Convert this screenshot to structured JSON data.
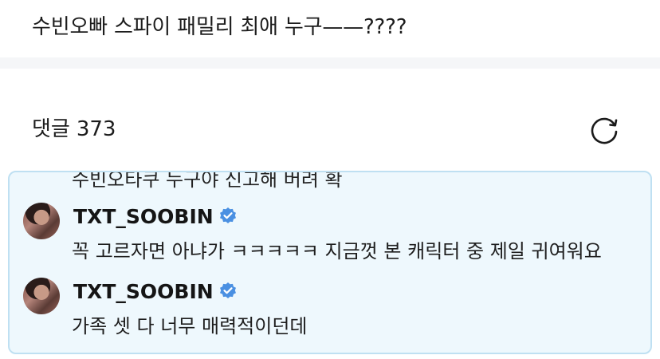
{
  "post": {
    "title": "수빈오빠 스파이 패밀리 최애 누구——????"
  },
  "comments": {
    "label": "댓글",
    "count": "373"
  },
  "thread": {
    "previous_text": "수빈오타쿠 누구야 신고해 버려 확",
    "replies": [
      {
        "username": "TXT_SOOBIN",
        "verified": true,
        "text": "꼭 고르자면 아냐가 ㅋㅋㅋㅋㅋ 지금껏 본 캐릭터 중 제일 귀여워요"
      },
      {
        "username": "TXT_SOOBIN",
        "verified": true,
        "text": "가족 셋 다 너무 매력적이던데"
      }
    ]
  },
  "colors": {
    "highlight_bg": "#eef8fd",
    "highlight_border": "#bfe0f2",
    "verified_badge": "#4a90e2"
  },
  "icons": {
    "refresh": "refresh-icon",
    "verified": "verified-badge-icon"
  }
}
